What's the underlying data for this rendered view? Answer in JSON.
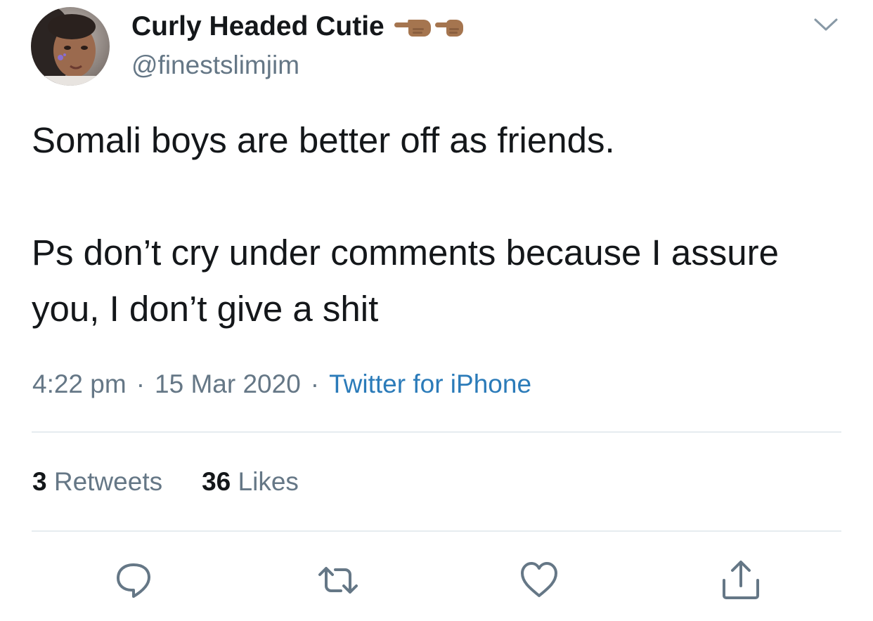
{
  "author": {
    "display_name": "Curly Headed Cutie",
    "name_emoji": "backhand-index-pointing-left-and-right-medium-dark-skin-tone",
    "handle": "@finestslimjim"
  },
  "tweet": {
    "paragraphs": [
      "Somali boys are better off as friends.",
      "Ps don’t cry under comments because I assure you, I don’t give a shit"
    ],
    "time": "4:22 pm",
    "separator": "·",
    "date": "15 Mar 2020",
    "source": "Twitter for iPhone"
  },
  "stats": {
    "retweets_count": "3",
    "retweets_label": "Retweets",
    "likes_count": "36",
    "likes_label": "Likes"
  },
  "actions": {
    "reply_icon": "reply-icon",
    "retweet_icon": "retweet-icon",
    "like_icon": "heart-icon",
    "share_icon": "share-icon"
  },
  "colors": {
    "text": "#14171a",
    "secondary": "#657786",
    "link": "#2b7bb9",
    "divider": "#e6ecf0",
    "emoji_skin": "#a5754f"
  }
}
